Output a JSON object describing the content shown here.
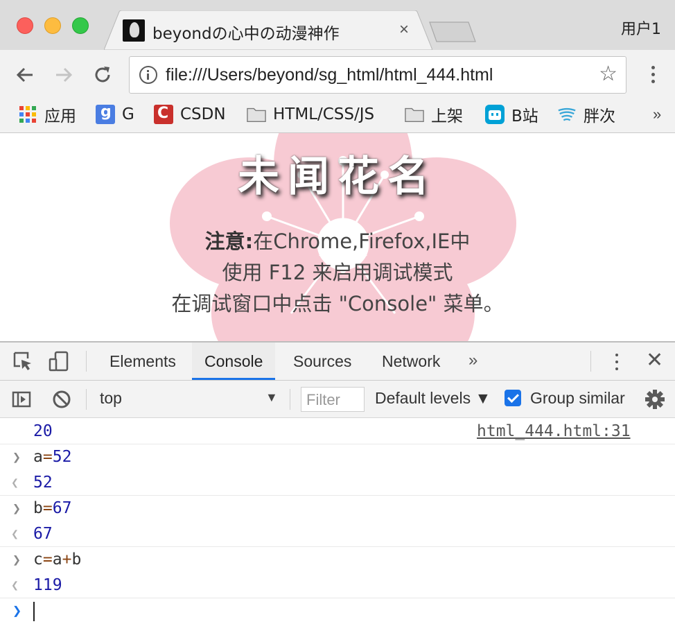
{
  "browser": {
    "tab_title": "beyondの心中の动漫神作",
    "tab_close": "×",
    "profile_name": "用户1",
    "url": "file:///Users/beyond/sg_html/html_444.html",
    "star": "☆",
    "bookmarks": [
      {
        "label": "应用",
        "icon": "apps-grid-icon"
      },
      {
        "label": "G",
        "icon": "google-icon"
      },
      {
        "label": "CSDN",
        "icon": "csdn-icon"
      },
      {
        "label": "HTML/CSS/JS",
        "icon": "folder-icon"
      },
      {
        "label": "上架",
        "icon": "folder-icon"
      },
      {
        "label": "B站",
        "icon": "bilibili-icon"
      },
      {
        "label": "胖次",
        "icon": "wave-icon"
      }
    ],
    "bookmarks_more": "»"
  },
  "page": {
    "title": "未闻花名",
    "notice_bold": "注意:",
    "notice_line1": "在Chrome,Firefox,IE中",
    "notice_line2": "使用 F12 来启用调试模式",
    "notice_line3": "在调试窗口中点击 \"Console\" 菜单。"
  },
  "devtools": {
    "tabs": [
      "Elements",
      "Console",
      "Sources",
      "Network"
    ],
    "active_tab": "Console",
    "more_tabs": "»",
    "close": "✕",
    "context": "top",
    "filter_placeholder": "Filter",
    "levels": "Default levels ▼",
    "group_similar": "Group similar",
    "group_similar_checked": true
  },
  "console": {
    "log_value": "20",
    "log_source": "html_444.html:31",
    "entries": [
      {
        "input_var": "a",
        "input_op": "=",
        "input_val": "52",
        "output": "52"
      },
      {
        "input_var": "b",
        "input_op": "=",
        "input_val": "67",
        "output": "67"
      },
      {
        "input_text_1": "c",
        "input_text_2": "a",
        "input_text_3": "b",
        "op1": "=",
        "op2": "+",
        "output": "119"
      }
    ]
  },
  "colors": {
    "accent": "#1a73e8",
    "console_number": "#1a1aa6",
    "flower": "#f7c9d2"
  }
}
